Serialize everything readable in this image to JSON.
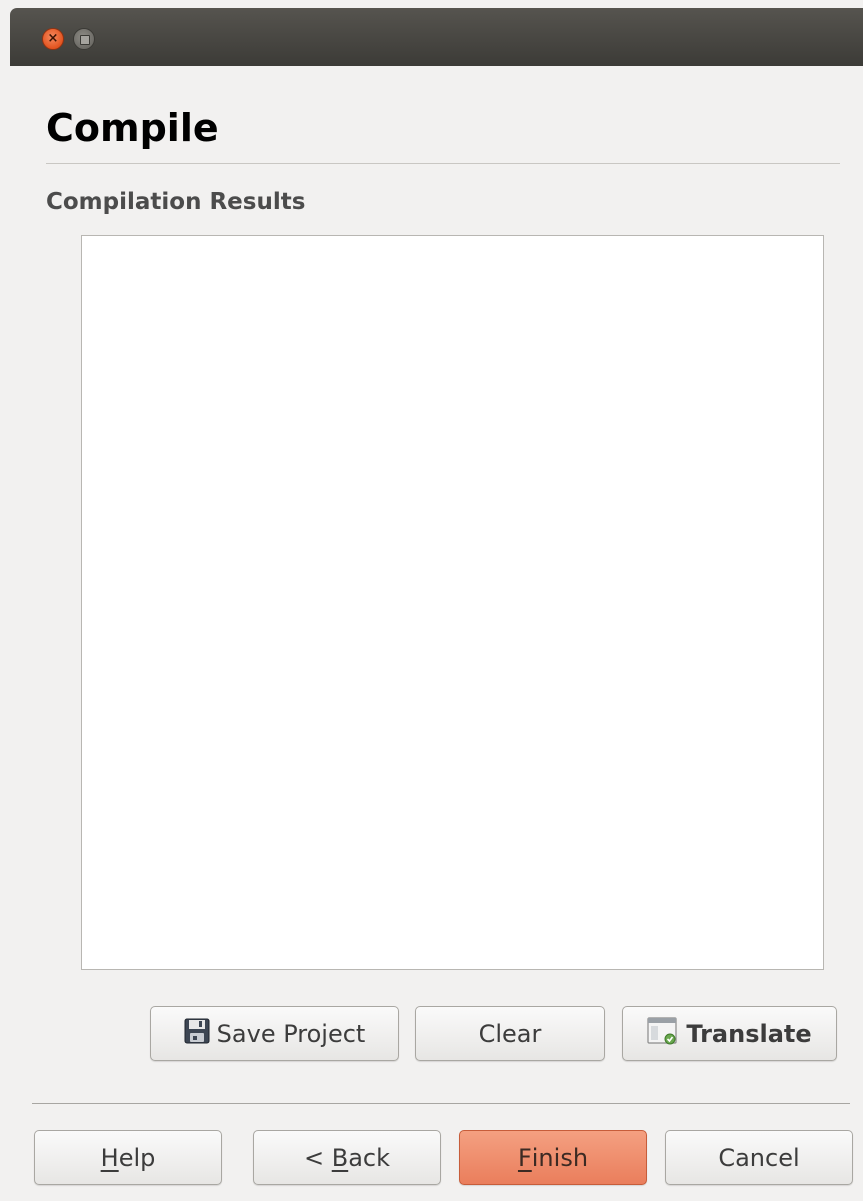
{
  "window": {
    "close_glyph": "×"
  },
  "page": {
    "title": "Compile",
    "section_label": "Compilation Results",
    "results_text": ""
  },
  "actions": {
    "save_project": {
      "label": "Save Project",
      "icon": "floppy-disk-icon"
    },
    "clear": {
      "label": "Clear"
    },
    "translate": {
      "label": "Translate",
      "icon": "translate-window-icon"
    }
  },
  "wizard": {
    "help": {
      "mnemonic": "H",
      "rest": "elp"
    },
    "back": {
      "prefix": "< ",
      "mnemonic": "B",
      "rest": "ack"
    },
    "finish": {
      "mnemonic": "F",
      "rest": "inish"
    },
    "cancel": {
      "label": "Cancel"
    }
  },
  "colors": {
    "finish_accent": "#ea7e5c",
    "close_button": "#e2531f",
    "window_bg": "#f2f1f0"
  }
}
